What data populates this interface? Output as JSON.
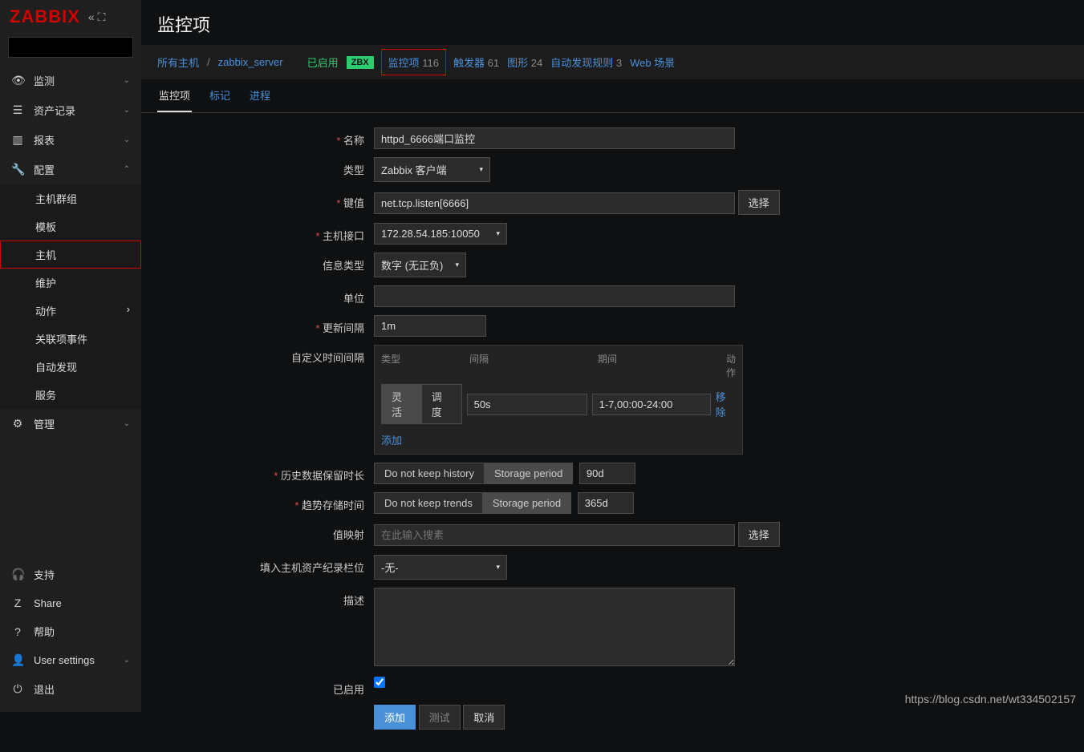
{
  "logo": "ZABBIX",
  "search": {
    "placeholder": ""
  },
  "nav": {
    "monitor": "监测",
    "inventory": "资产记录",
    "reports": "报表",
    "config": "配置",
    "admin": "管理",
    "config_sub": {
      "hostgroups": "主机群组",
      "templates": "模板",
      "hosts": "主机",
      "maintenance": "维护",
      "actions": "动作",
      "correlation": "关联项事件",
      "discovery": "自动发现",
      "services": "服务"
    },
    "footer": {
      "support": "支持",
      "share": "Share",
      "help": "帮助",
      "usersettings": "User settings",
      "logout": "退出"
    }
  },
  "page": {
    "title": "监控项"
  },
  "breadcrumb": {
    "allhosts": "所有主机",
    "host": "zabbix_server",
    "enabled": "已启用",
    "zbx": "ZBX",
    "items": {
      "label": "监控项",
      "count": "116"
    },
    "triggers": {
      "label": "触发器",
      "count": "61"
    },
    "graphs": {
      "label": "图形",
      "count": "24"
    },
    "discovery": {
      "label": "自动发现规则",
      "count": "3"
    },
    "web": {
      "label": "Web 场景"
    }
  },
  "tabs": {
    "item": "监控项",
    "tags": "标记",
    "process": "进程"
  },
  "form": {
    "name": {
      "label": "名称",
      "value": "httpd_6666端口监控"
    },
    "type": {
      "label": "类型",
      "value": "Zabbix 客户端"
    },
    "key": {
      "label": "键值",
      "value": "net.tcp.listen[6666]",
      "btn": "选择"
    },
    "hostiface": {
      "label": "主机接口",
      "value": "172.28.54.185:10050"
    },
    "infotype": {
      "label": "信息类型",
      "value": "数字 (无正负)"
    },
    "units": {
      "label": "单位",
      "value": ""
    },
    "interval": {
      "label": "更新间隔",
      "value": "1m"
    },
    "customint": {
      "label": "自定义时间间隔",
      "head": {
        "type": "类型",
        "interval": "间隔",
        "period": "期间",
        "action": "动作"
      },
      "seg": {
        "flex": "灵活",
        "sched": "调度"
      },
      "row": {
        "interval": "50s",
        "period": "1-7,00:00-24:00",
        "remove": "移除"
      },
      "add": "添加"
    },
    "history": {
      "label": "历史数据保留时长",
      "opt1": "Do not keep history",
      "opt2": "Storage period",
      "value": "90d"
    },
    "trends": {
      "label": "趋势存储时间",
      "opt1": "Do not keep trends",
      "opt2": "Storage period",
      "value": "365d"
    },
    "valuemap": {
      "label": "值映射",
      "placeholder": "在此输入搜素",
      "btn": "选择"
    },
    "inventory": {
      "label": "填入主机资产纪录栏位",
      "value": "-无-"
    },
    "desc": {
      "label": "描述"
    },
    "enabled": {
      "label": "已启用"
    },
    "buttons": {
      "add": "添加",
      "test": "测试",
      "cancel": "取消"
    }
  },
  "watermark": "https://blog.csdn.net/wt334502157"
}
